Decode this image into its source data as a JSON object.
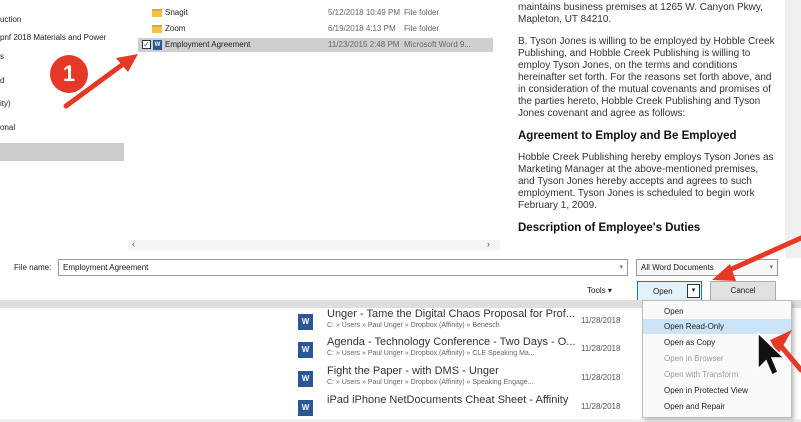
{
  "nav": {
    "items": [
      "uction",
      "pnf 2018 Materials and Power",
      "s",
      "d",
      "ity)",
      "onal"
    ]
  },
  "files": {
    "rows": [
      {
        "name": "Snagit",
        "date": "5/12/2018 10:49 PM",
        "type": "File folder",
        "kind": "folder",
        "selected": false
      },
      {
        "name": "Zoom",
        "date": "6/19/2018 4:13 PM",
        "type": "File folder",
        "kind": "folder",
        "selected": false
      },
      {
        "name": "Employment Agreement",
        "date": "11/23/2015 2:48 PM",
        "type": "Microsoft Word 9...",
        "kind": "word",
        "selected": true
      }
    ]
  },
  "preview": {
    "p1": "maintains business premises at 1265 W. Canyon Pkwy, Mapleton, UT 84210.",
    "p2": "B. Tyson Jones is willing to be employed by Hobble Creek Publishing, and Hobble Creek Publishing is willing to employ Tyson Jones, on the terms and conditions hereinafter set forth. For the reasons set forth above, and in consideration of the mutual covenants and promises of the parties hereto, Hobble Creek Publishing and Tyson Jones covenant and agree as follows:",
    "h1": "Agreement to Employ and Be Employed",
    "p3": "Hobble Creek Publishing hereby employs Tyson Jones as Marketing Manager at the above-mentioned premises, and Tyson Jones hereby accepts and agrees to such employment. Tyson Jones is scheduled to begin work February 1, 2009.",
    "h2": "Description of Employee's Duties"
  },
  "footer": {
    "filename_label": "File name:",
    "filename_value": "Employment Agreement",
    "filetype_value": "All Word Documents",
    "tools_label": "Tools",
    "open_label": "Open",
    "cancel_label": "Cancel"
  },
  "open_menu": {
    "items": [
      {
        "label": "Open",
        "state": "normal"
      },
      {
        "label": "Open Read-Only",
        "state": "highlighted"
      },
      {
        "label": "Open as Copy",
        "state": "normal"
      },
      {
        "label": "Open in Browser",
        "state": "disabled"
      },
      {
        "label": "Open with Transform",
        "state": "disabled"
      },
      {
        "label": "Open in Protected View",
        "state": "normal"
      },
      {
        "label": "Open and Repair",
        "state": "normal"
      }
    ]
  },
  "recent": {
    "docs": [
      {
        "title": "Unger - Tame the Digital Chaos Proposal for Prof...",
        "path": "C: » Users » Paul Unger » Dropbox (Affinity) » Benesch",
        "date": "11/28/2018"
      },
      {
        "title": "Agenda - Technology Conference - Two Days - O...",
        "path": "C: » Users » Paul Unger » Dropbox (Affinity) » CLE Speaking Ma...",
        "date": "11/28/2018"
      },
      {
        "title": "Fight the Paper - with DMS - Unger",
        "path": "C: » Users » Paul Unger » Dropbox (Affinity) » Speaking Engage...",
        "date": "11/28/2018"
      },
      {
        "title": "iPad iPhone NetDocuments Cheat Sheet - Affinity",
        "path": "",
        "date": "11/28/2018"
      }
    ]
  },
  "annotation": {
    "step_number": "1",
    "arrow_color": "#e53927"
  }
}
